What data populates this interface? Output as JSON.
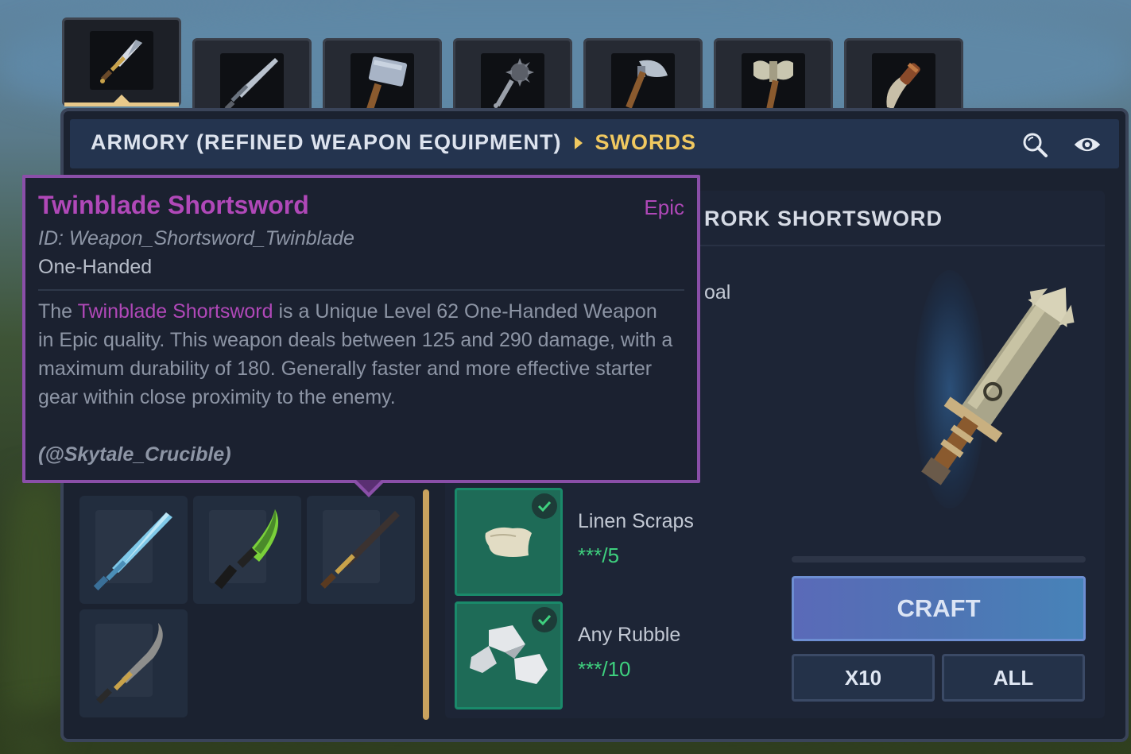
{
  "tabs": [
    {
      "id": "swords",
      "icon": "dagger-icon",
      "active": true
    },
    {
      "id": "longswords",
      "icon": "longsword-icon",
      "active": false
    },
    {
      "id": "hammers",
      "icon": "hammer-icon",
      "active": false
    },
    {
      "id": "maces",
      "icon": "mace-icon",
      "active": false
    },
    {
      "id": "axes",
      "icon": "axe-icon",
      "active": false
    },
    {
      "id": "greataxes",
      "icon": "double-axe-icon",
      "active": false
    },
    {
      "id": "knives",
      "icon": "knife-icon",
      "active": false
    }
  ],
  "header": {
    "category": "ARMORY (REFINED WEAPON EQUIPMENT)",
    "current": "SWORDS",
    "search_icon": "search-icon",
    "visibility_icon": "eye-icon"
  },
  "detail": {
    "title_partial": "RORK SHORTSWORD",
    "partial_text": "oal"
  },
  "recipes": [
    {
      "icon": "ice-sword-icon"
    },
    {
      "icon": "green-blade-icon"
    },
    {
      "icon": "dark-longsword-icon"
    },
    {
      "icon": "curved-sword-icon"
    }
  ],
  "ingredients": [
    {
      "name": "Linen Scraps",
      "qty": "***/5",
      "icon": "linen-scraps-icon",
      "checked": true
    },
    {
      "name": "Any Rubble",
      "qty": "***/10",
      "icon": "rubble-icon",
      "checked": true
    }
  ],
  "craft": {
    "craft_label": "CRAFT",
    "x10_label": "X10",
    "all_label": "ALL"
  },
  "tooltip": {
    "title": "Twinblade Shortsword",
    "rarity": "Epic",
    "id_line": "ID: Weapon_Shortsword_Twinblade",
    "type": "One-Handed",
    "desc_pre": "The ",
    "desc_name": "Twinblade Shortsword",
    "desc_post": " is a Unique Level 62 One-Handed Weapon in Epic quality. This weapon deals between 125 and 290 damage, with a maximum durability of 180. Generally faster and more effective starter gear within close proximity to the enemy.",
    "author": "(@Skytale_Crucible)"
  },
  "colors": {
    "accent_gold": "#f0c860",
    "epic_purple": "#b048b8",
    "ingredient_green": "#3ed07e",
    "craft_blue": "#4f74b4"
  }
}
